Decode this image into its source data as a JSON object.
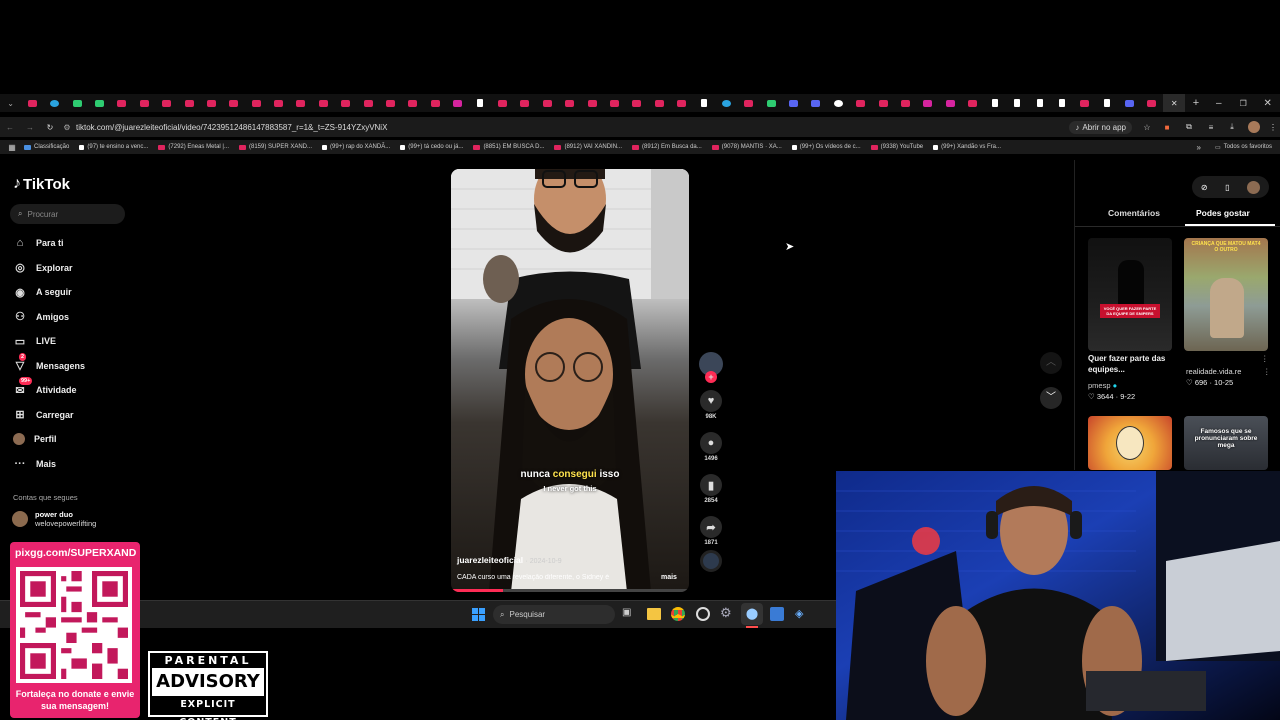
{
  "browser": {
    "url": "tiktok.com/@juarezleiteoficial/video/74239512486147883587_r=1&_t=ZS-914YZxyVNiX",
    "open_app": "Abrir no app",
    "all_bookmarks": "Todos os favoritos",
    "bookmarks": [
      {
        "label": "Classificação",
        "type": "g"
      },
      {
        "label": "(97) te ensino a venc...",
        "type": "tt"
      },
      {
        "label": "(7292) Eneas Metal |...",
        "type": "yt"
      },
      {
        "label": "(8159) SUPER XAND...",
        "type": "yt"
      },
      {
        "label": "(99+) rap do XANDÃ...",
        "type": "tt"
      },
      {
        "label": "(99+) tá cedo ou já...",
        "type": "tt"
      },
      {
        "label": "(8851) EM BUSCA D...",
        "type": "yt"
      },
      {
        "label": "(8912) VAI XANDIN...",
        "type": "yt"
      },
      {
        "label": "(8912) Em Busca da...",
        "type": "yt"
      },
      {
        "label": "(9078) MANTIS · XA...",
        "type": "yt"
      },
      {
        "label": "(99+) Os vídeos de c...",
        "type": "tt"
      },
      {
        "label": "(9338) YouTube",
        "type": "yt"
      },
      {
        "label": "(99+) Xandão vs Fra...",
        "type": "tt"
      }
    ],
    "tabs": [
      "yt",
      "tg",
      "gr",
      "gr",
      "yt",
      "yt",
      "yt",
      "yt",
      "yt",
      "yt",
      "yt",
      "yt",
      "yt",
      "yt",
      "yt",
      "yt",
      "yt",
      "yt",
      "yt",
      "ig",
      "tt",
      "yt",
      "yt",
      "yt",
      "yt",
      "yt",
      "yt",
      "yt",
      "yt",
      "yt",
      "tt",
      "tg",
      "yt",
      "gr",
      "bl",
      "bl",
      "go",
      "yt",
      "yt",
      "yt",
      "ig",
      "ig",
      "yt",
      "tt",
      "tt",
      "tt",
      "tt",
      "yt",
      "tt",
      "bl",
      "yt",
      "act"
    ]
  },
  "tiktok": {
    "logo": "TikTok",
    "search_placeholder": "Procurar",
    "nav": [
      {
        "label": "Para ti",
        "icon": "home-icon"
      },
      {
        "label": "Explorar",
        "icon": "compass-icon"
      },
      {
        "label": "A seguir",
        "icon": "following-icon"
      },
      {
        "label": "Amigos",
        "icon": "friends-icon"
      },
      {
        "label": "LIVE",
        "icon": "live-icon"
      },
      {
        "label": "Mensagens",
        "icon": "messages-icon",
        "badge": "2"
      },
      {
        "label": "Atividade",
        "icon": "activity-icon",
        "badge": "99+"
      },
      {
        "label": "Carregar",
        "icon": "upload-icon"
      },
      {
        "label": "Perfil",
        "icon": "profile-icon"
      },
      {
        "label": "Mais",
        "icon": "more-icon"
      }
    ],
    "following_title": "Contas que segues",
    "following": [
      {
        "name": "power duo",
        "handle": "welovepowerlifting"
      }
    ],
    "video": {
      "caption_pt_1": "nunca ",
      "caption_pt_2": "consegui",
      "caption_pt_3": " isso",
      "caption_en": "I never got this",
      "author": "juarezleiteoficial",
      "date": "· 2024-10-9",
      "desc": "CADA curso uma revelação diferente, o Sidney é",
      "more": "mais",
      "likes": "98K",
      "comments": "1496",
      "saves": "2854",
      "shares": "1871"
    },
    "tabs": {
      "comments": "Comentários",
      "may_like": "Podes gostar"
    },
    "cards": [
      {
        "title": "Quer fazer parte das equipes...",
        "author": "pmesp",
        "likes": "3644",
        "date": "9-22",
        "overlay": "VOCÊ QUER FAZER PARTE DA EQUIPE DE SNIPERS"
      },
      {
        "title": "realidade.vida.re",
        "author": "",
        "likes": "696",
        "date": "10-25",
        "overlay": "CRIANÇA QUE MATOU MAT4 O OUTRO"
      },
      {
        "overlay": ""
      },
      {
        "overlay": "Famosos que se pronunciaram sobre mega"
      }
    ]
  },
  "taskbar": {
    "search": "Pesquisar"
  },
  "overlays": {
    "qr_url": "pixgg.com/SUPERXAND",
    "qr_text": "Fortaleça no donate e envie sua mensagem!",
    "pa_line1": "PARENTAL",
    "pa_line2": "ADVISORY",
    "pa_line3": "EXPLICIT CONTENT"
  },
  "colors": {
    "tiktok_red": "#fe2c55",
    "tiktok_cyan": "#25f4ee",
    "highlight_yellow": "#ffe34d",
    "donate_pink": "#e8246e"
  }
}
